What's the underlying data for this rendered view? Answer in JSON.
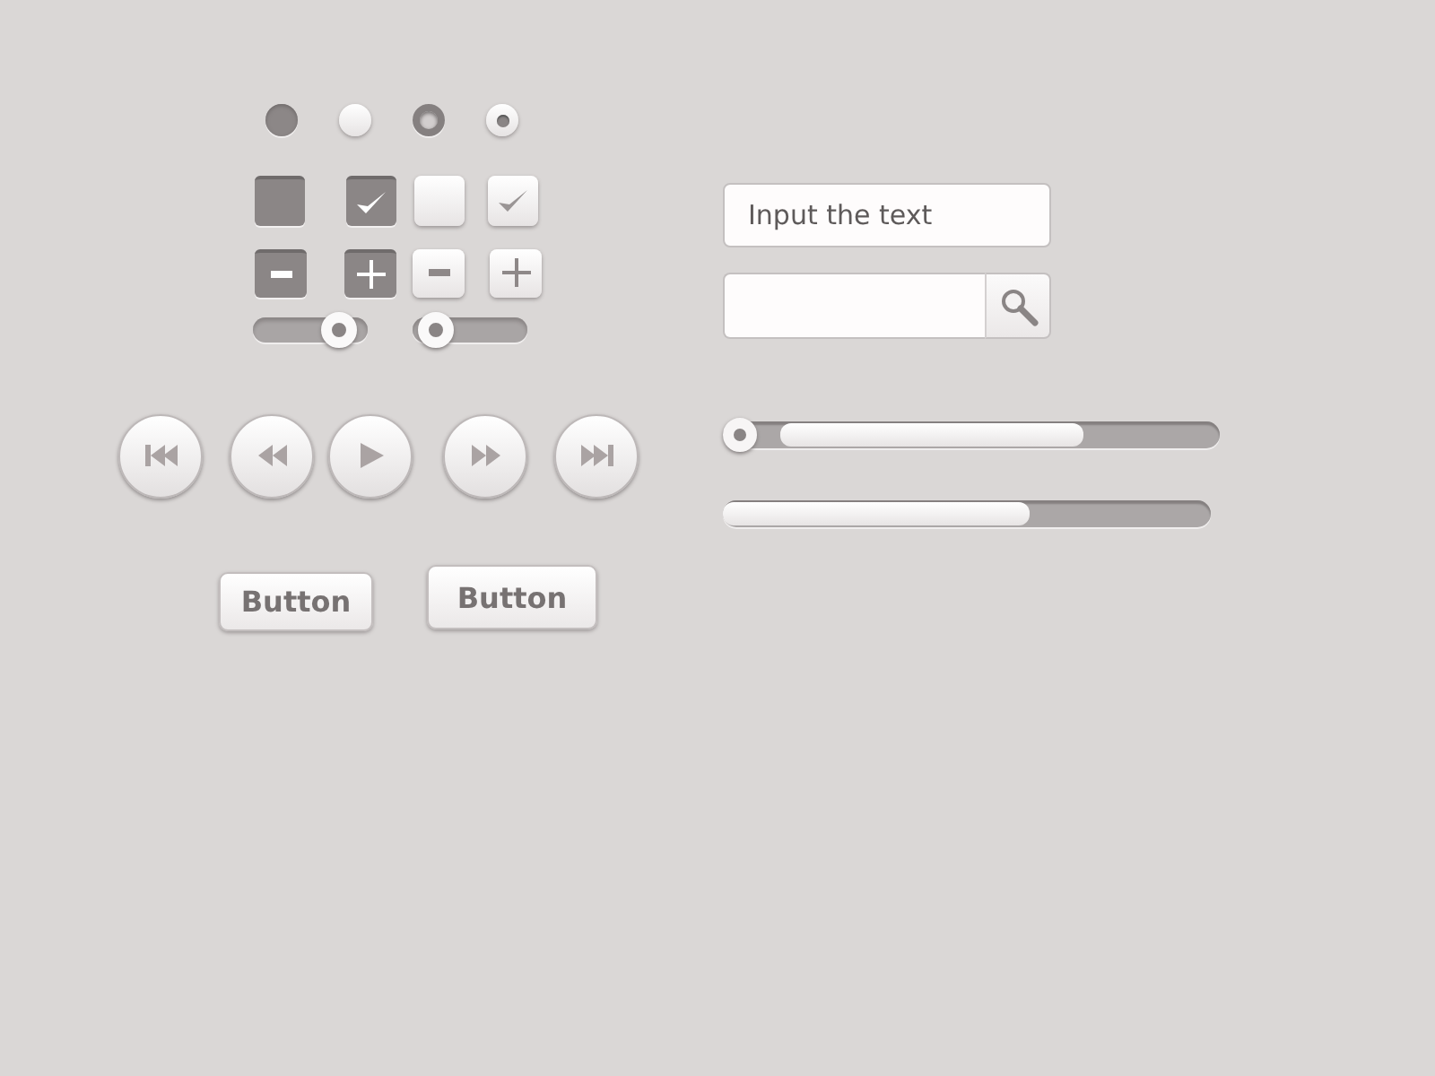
{
  "radios": [
    {
      "kind": "dark",
      "selected": false
    },
    {
      "kind": "light",
      "selected": false
    },
    {
      "kind": "dark",
      "selected": true
    },
    {
      "kind": "light",
      "selected": true
    }
  ],
  "checkboxes": [
    {
      "kind": "dark",
      "checked": false
    },
    {
      "kind": "dark",
      "checked": true
    },
    {
      "kind": "light",
      "checked": false
    },
    {
      "kind": "light",
      "checked": true
    }
  ],
  "steppers": [
    {
      "kind": "minus-dark"
    },
    {
      "kind": "plus-dark"
    },
    {
      "kind": "minus-light"
    },
    {
      "kind": "plus-light"
    }
  ],
  "mini_sliders": [
    {
      "level": 0.86
    },
    {
      "level": 0.06
    }
  ],
  "media_buttons": [
    {
      "kind": "skip-back"
    },
    {
      "kind": "rewind"
    },
    {
      "kind": "play"
    },
    {
      "kind": "fast-forward"
    },
    {
      "kind": "skip-forward"
    }
  ],
  "buttons": [
    {
      "label": "Button",
      "kind": "small"
    },
    {
      "label": "Button",
      "kind": "large"
    }
  ],
  "text_field": {
    "placeholder": "Input the text"
  },
  "seek_bar": {
    "thumb": {
      "level": 0
    }
  },
  "progress_bar": {
    "level": 0.63
  }
}
